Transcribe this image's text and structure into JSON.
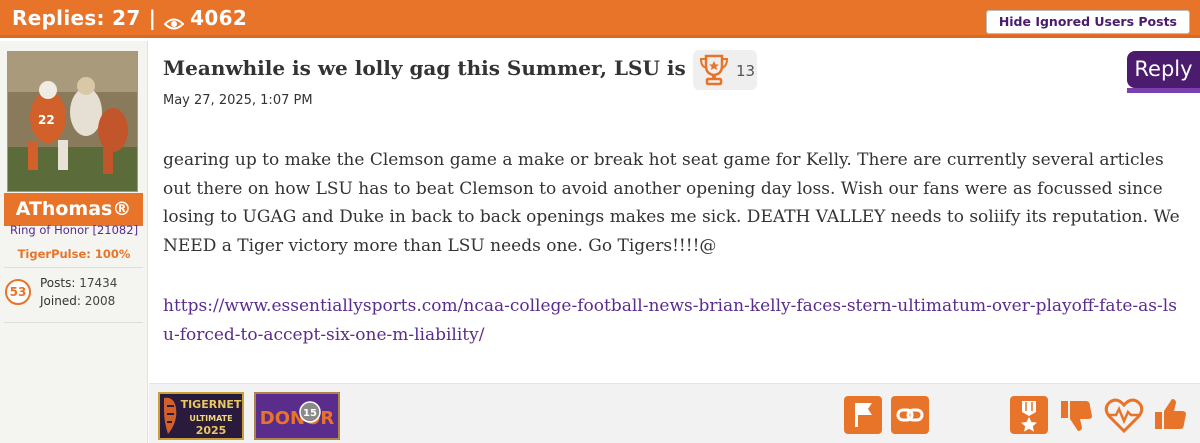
{
  "header": {
    "replies_text": "Replies: 27",
    "separator": "|",
    "views": "4062",
    "hide_ignored_label": "Hide Ignored Users Posts",
    "eye_icon": "eye-icon"
  },
  "user": {
    "name": "AThomas®",
    "ring_of_honor": "Ring of Honor [21082]",
    "tigerpulse": "TigerPulse: 100%",
    "badge_number": "53",
    "posts_label": "Posts:",
    "posts": "17434",
    "joined_label": "Joined:",
    "joined": "2008"
  },
  "post": {
    "title": "Meanwhile is we lolly gag this Summer, LSU is",
    "trophy_count": "13",
    "date": "May 27, 2025, 1:07 PM",
    "body": "gearing up to make the Clemson game a make or break hot seat game for Kelly. There are currently several articles out there on how LSU has to beat Clemson to avoid another opening day loss. Wish our fans were as focussed since losing to UGAG and Duke in back to back openings makes me sick. DEATH VALLEY needs to soliify its reputation. We NEED a Tiger victory more than LSU needs one. Go Tigers!!!!@",
    "link": "https://www.essentiallysports.com/ncaa-college-football-news-brian-kelly-faces-stern-ultimatum-over-playoff-fate-as-lsu-forced-to-accept-six-one-m-liability/",
    "reply_label": "Reply"
  },
  "badges": {
    "tigernet_word": "TIGERNET",
    "ultimate_word": "ULTIMATE",
    "year": "2025",
    "donor_word": "DONOR",
    "donor_number": "15"
  },
  "colors": {
    "orange": "#e8742a",
    "purple": "#4b1b6e",
    "link_purple": "#5a2c8c"
  }
}
